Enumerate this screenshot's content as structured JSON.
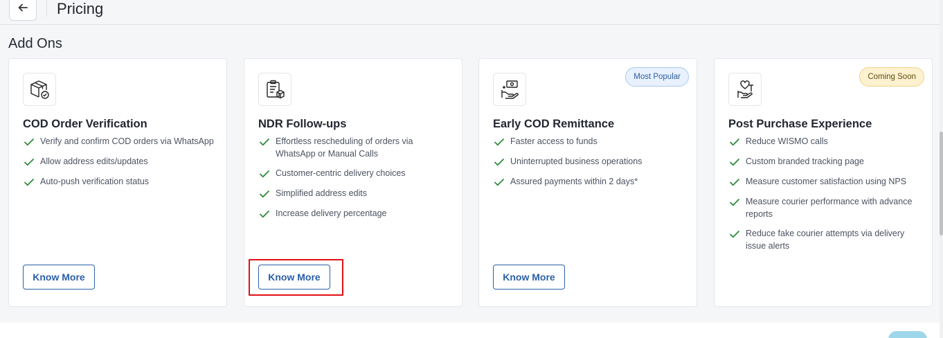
{
  "header": {
    "back_icon": "arrow-left-icon",
    "title": "Pricing"
  },
  "section": {
    "title": "Add Ons"
  },
  "colors": {
    "accent": "#2a5fa8",
    "check": "#2e8b3e",
    "highlight": "#e10f14"
  },
  "cards": [
    {
      "icon": "box-check-icon",
      "title": "COD Order Verification",
      "badge": "",
      "features": [
        "Verify and confirm COD orders via WhatsApp",
        "Allow address edits/updates",
        "Auto-push verification status"
      ],
      "button": "Know More"
    },
    {
      "icon": "clipboard-box-icon",
      "title": "NDR Follow-ups",
      "badge": "",
      "features": [
        "Effortless rescheduling of orders via WhatsApp or Manual Calls",
        "Customer-centric delivery choices",
        "Simplified address edits",
        "Increase delivery percentage"
      ],
      "button": "Know More"
    },
    {
      "icon": "cash-hand-icon",
      "title": "Early COD Remittance",
      "badge": "Most Popular",
      "features": [
        "Faster access to funds",
        "Uninterrupted business operations",
        "Assured payments within 2 days*"
      ],
      "button": "Know More"
    },
    {
      "icon": "heart-hand-icon",
      "title": "Post Purchase Experience",
      "badge": "Coming Soon",
      "features": [
        "Reduce WISMO calls",
        "Custom branded tracking page",
        "Measure customer satisfaction using NPS",
        "Measure courier performance with advance reports",
        "Reduce fake courier attempts via delivery issue alerts"
      ],
      "button": ""
    }
  ]
}
